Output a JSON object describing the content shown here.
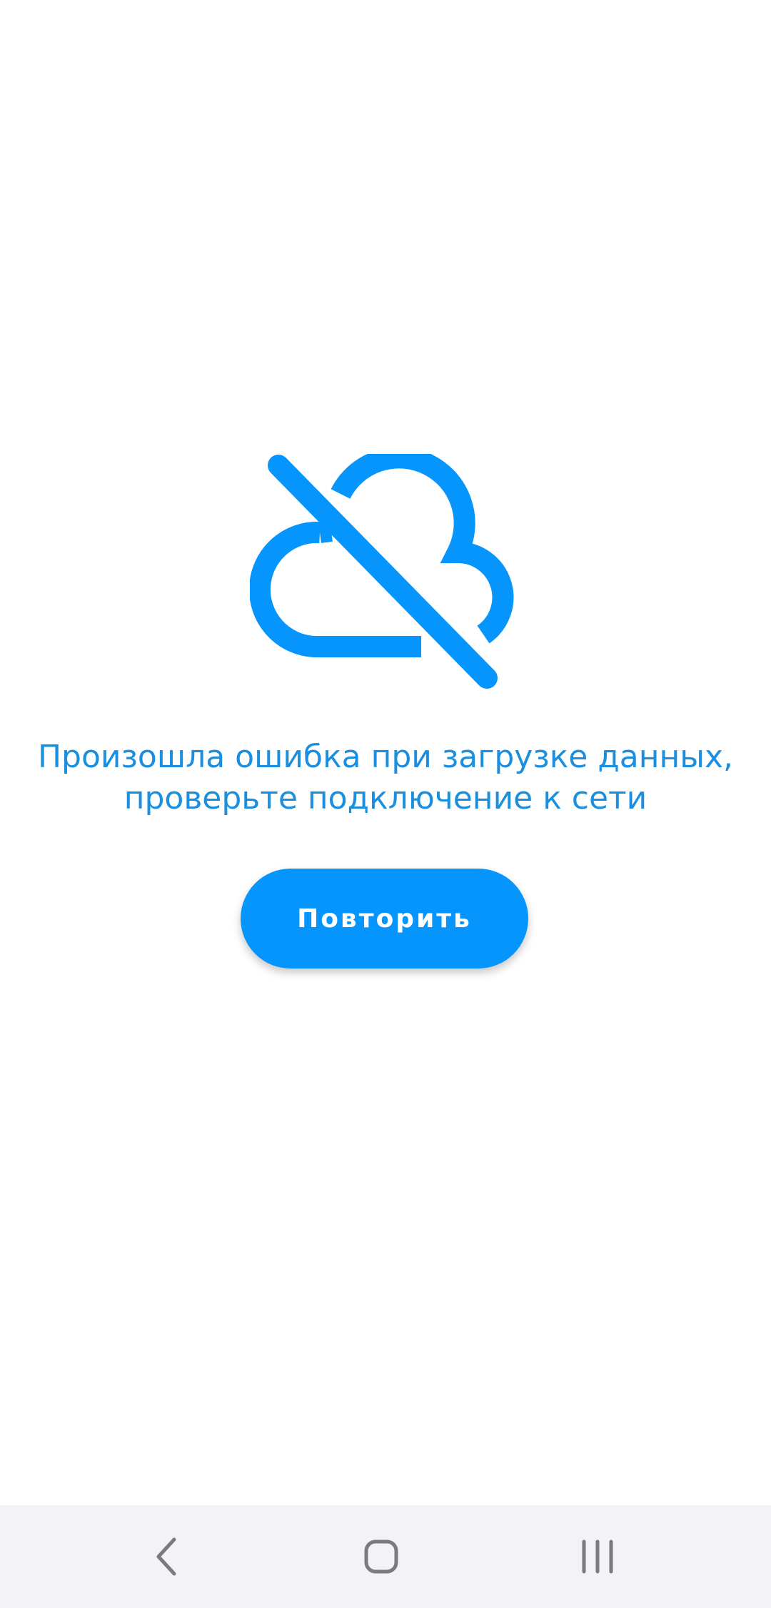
{
  "error": {
    "icon": "cloud-off-icon",
    "message_line1": "Произошла ошибка при загрузке данных,",
    "message_line2": "проверьте подключение к сети",
    "retry_label": "Повторить"
  },
  "navigation_bar": {
    "back": "back-icon",
    "home": "home-icon",
    "recents": "recents-icon"
  },
  "colors": {
    "accent": "#0595fc",
    "message_text": "#1a8fe0",
    "background": "#ffffff",
    "nav_background": "#f3f3f5",
    "nav_icons": "#7a7a80"
  }
}
